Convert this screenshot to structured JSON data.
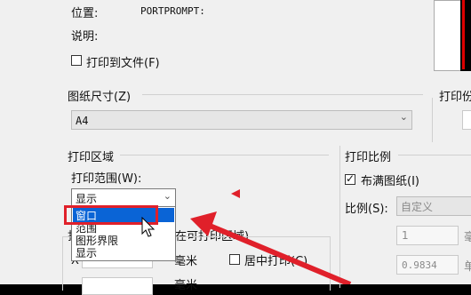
{
  "top": {
    "location_label": "位置:",
    "location_value": "PORTPROMPT:",
    "description_label": "说明:",
    "print_to_file": "打印到文件(F)"
  },
  "paper": {
    "title": "图纸尺寸(Z)",
    "value": "A4"
  },
  "copies_title_partial": "打印份",
  "print_area": {
    "title": "打印区域",
    "range_label": "打印范围(W):",
    "range_value": "显示",
    "options": [
      "窗口",
      "范围",
      "图形界限",
      "显示"
    ],
    "highlighted_option": "窗口"
  },
  "offset": {
    "title_partial": "打",
    "title_tail": "在可打印区域)",
    "mm_label": "毫米",
    "center_label": "居中打印(C)",
    "x_prefix": "X",
    "mm_label2": "毫米"
  },
  "scale": {
    "title": "打印比例",
    "fit_label": "布满图纸(I)",
    "fit_checked": true,
    "ratio_label": "比例(S):",
    "ratio_value": "自定义",
    "value1": "1",
    "value2": "0.9834",
    "unit1_partial": "毫",
    "unit2_partial": "单"
  },
  "colors": {
    "annotation_red": "#e0202a",
    "highlight_blue": "#0a64d6"
  }
}
